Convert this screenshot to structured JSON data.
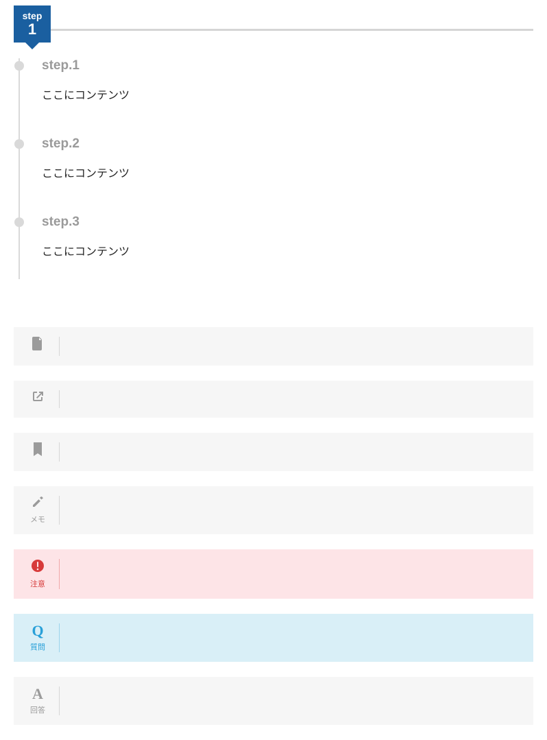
{
  "badge": {
    "label": "step",
    "num": "1"
  },
  "timeline": [
    {
      "title": "step.1",
      "content": "ここにコンテンツ"
    },
    {
      "title": "step.2",
      "content": "ここにコンテンツ"
    },
    {
      "title": "step.3",
      "content": "ここにコンテンツ"
    }
  ],
  "panels": {
    "doc": {
      "label": ""
    },
    "external": {
      "label": ""
    },
    "bookmark": {
      "label": ""
    },
    "memo": {
      "label": "メモ"
    },
    "warning": {
      "label": "注意"
    },
    "question": {
      "letter": "Q",
      "label": "質問"
    },
    "answer": {
      "letter": "A",
      "label": "回答"
    }
  }
}
